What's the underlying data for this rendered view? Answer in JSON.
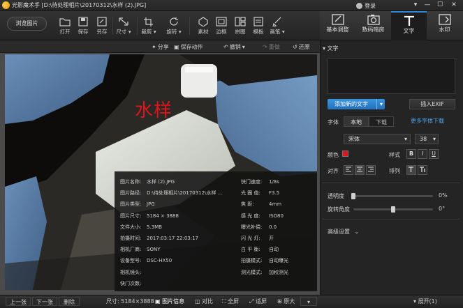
{
  "window": {
    "title": "光影魔术手 [D:\\待处理相片\\20170312\\水样 (2).JPG]",
    "login_label": "登录",
    "controls": [
      "▾",
      "—",
      "☐",
      "✕"
    ]
  },
  "toolbar": {
    "browse_label": "浏览图片",
    "tools": [
      "打开",
      "保存",
      "另存",
      "尺寸",
      "裁剪",
      "旋转",
      "素材",
      "边框",
      "拼图",
      "模板",
      "画笔"
    ],
    "dropdown_arrow": "▾"
  },
  "right_tabs": [
    "基本调整",
    "数码暗房",
    "文字",
    "水印"
  ],
  "subbar": {
    "share": "分享",
    "save_action": "保存动作",
    "undo": "撤销",
    "redo": "重做",
    "restore": "还原"
  },
  "photo": {
    "watermark_text": "水样"
  },
  "info": {
    "left": [
      {
        "label": "图片名称:",
        "value": "水样 (2).JPG"
      },
      {
        "label": "图片路径:",
        "value": "D:\\待处理相片\\20170312\\水样 ..."
      },
      {
        "label": "图片类型:",
        "value": "JPG"
      },
      {
        "label": "图片尺寸:",
        "value": "5184 × 3888"
      },
      {
        "label": "文件大小:",
        "value": "5.3MB"
      },
      {
        "label": "拍摄时间:",
        "value": "2017:03:17 22:03:17"
      },
      {
        "label": "相机厂商:",
        "value": "SONY"
      },
      {
        "label": "设备型号:",
        "value": "DSC-HX50"
      },
      {
        "label": "相机镜头:",
        "value": ""
      },
      {
        "label": "快门次数:",
        "value": ""
      }
    ],
    "right": [
      {
        "label": "快门速度:",
        "value": "1/8s"
      },
      {
        "label": "光 圈 值:",
        "value": "F3.5"
      },
      {
        "label": "焦    距:",
        "value": "4mm"
      },
      {
        "label": "感 光 度:",
        "value": "ISO80"
      },
      {
        "label": "曝光补偿:",
        "value": "0.0"
      },
      {
        "label": "闪 光 灯:",
        "value": "开"
      },
      {
        "label": "白 平 衡:",
        "value": "自动"
      },
      {
        "label": "拍摄模式:",
        "value": "自动曝光"
      },
      {
        "label": "测光模式:",
        "value": "加权测光"
      }
    ]
  },
  "panel": {
    "section_title": "文字",
    "add_text": "添加新的文字",
    "insert_exif": "插入EXIF",
    "font_label": "字体",
    "font_local": "本地",
    "font_download": "下载",
    "more_fonts": "更多字体下载",
    "font_name": "宋体",
    "font_size": "38",
    "color_label": "颜色",
    "color_value": "#e0141b",
    "style_label": "样式",
    "style_buttons": [
      "B",
      "I",
      "U"
    ],
    "align_label": "对齐",
    "layout_label": "排列",
    "opacity_label": "透明度",
    "opacity_value": "0%",
    "opacity_fraction": 0,
    "rotate_label": "旋转角度",
    "rotate_value": "0°",
    "rotate_fraction": 0.5,
    "advanced_label": "高级设置"
  },
  "bottombar": {
    "prev": "上一张",
    "next": "下一张",
    "delete": "删除",
    "size_text": "尺寸: 5184×3888",
    "info": "图片信息",
    "compare": "对比",
    "fullscreen": "全屏",
    "fit": "适屏",
    "zoom": "原大",
    "expand": "展开(1)"
  }
}
